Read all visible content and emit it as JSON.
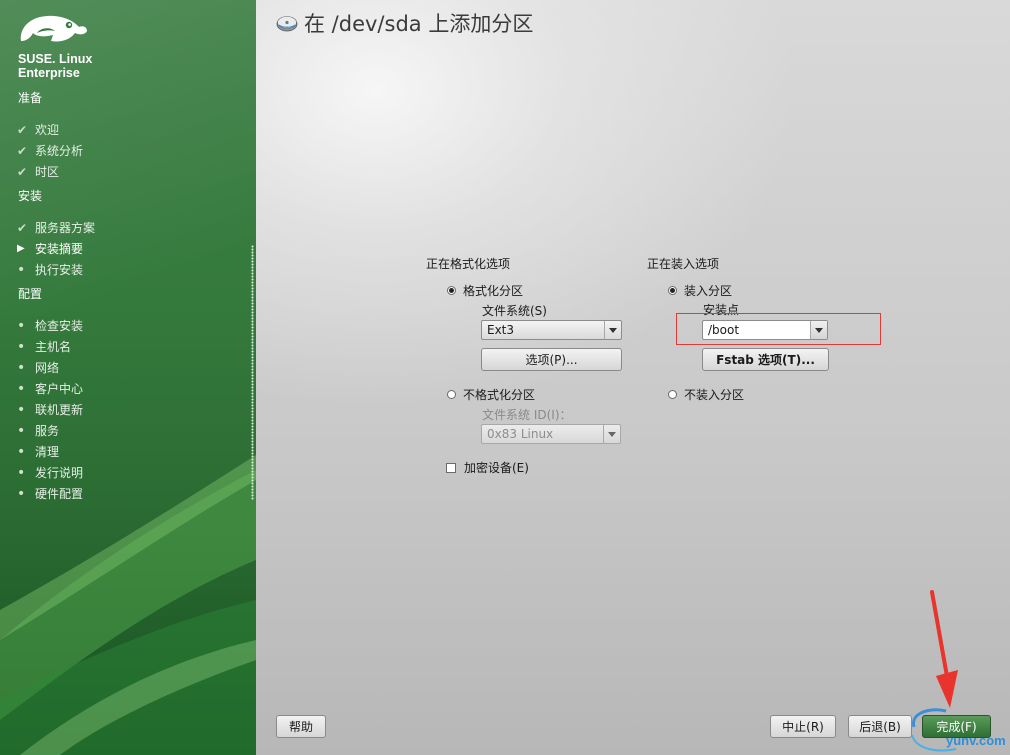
{
  "sidebar": {
    "brand_line1": "SUSE. Linux",
    "brand_line2": "Enterprise",
    "groups": {
      "prepare": "准备",
      "install": "安装",
      "config": "配置"
    },
    "steps": {
      "welcome": "欢迎",
      "system_analysis": "系统分析",
      "timezone": "时区",
      "server_scenario": "服务器方案",
      "install_summary": "安装摘要",
      "perform_install": "执行安装",
      "check_install": "检查安装",
      "hostname": "主机名",
      "network": "网络",
      "customer_center": "客户中心",
      "online_update": "联机更新",
      "services": "服务",
      "cleanup": "清理",
      "release_notes": "发行说明",
      "hardware_config": "硬件配置"
    }
  },
  "main": {
    "title": "在 /dev/sda 上添加分区",
    "format_section": {
      "title": "正在格式化选项",
      "format_radio": "格式化分区",
      "filesystem_label": "文件系统(S)",
      "filesystem_value": "Ext3",
      "options_button": "选项(P)...",
      "no_format_radio": "不格式化分区",
      "fs_id_label": "文件系统 ID(I)：",
      "fs_id_value": "0x83 Linux",
      "encrypt_checkbox": "加密设备(E)"
    },
    "mount_section": {
      "title": "正在装入选项",
      "mount_radio": "装入分区",
      "mount_point_label": "安装点",
      "mount_point_value": "/boot",
      "fstab_button": "Fstab 选项(T)...",
      "no_mount_radio": "不装入分区"
    }
  },
  "footer": {
    "help": "帮助",
    "abort": "中止(R)",
    "back": "后退(B)",
    "finish": "完成(F)"
  },
  "watermark": "yunv.com",
  "colors": {
    "sidebar_green": "#357a3d",
    "highlight_red": "#e23a3a",
    "annotation_red": "#e8342c"
  }
}
